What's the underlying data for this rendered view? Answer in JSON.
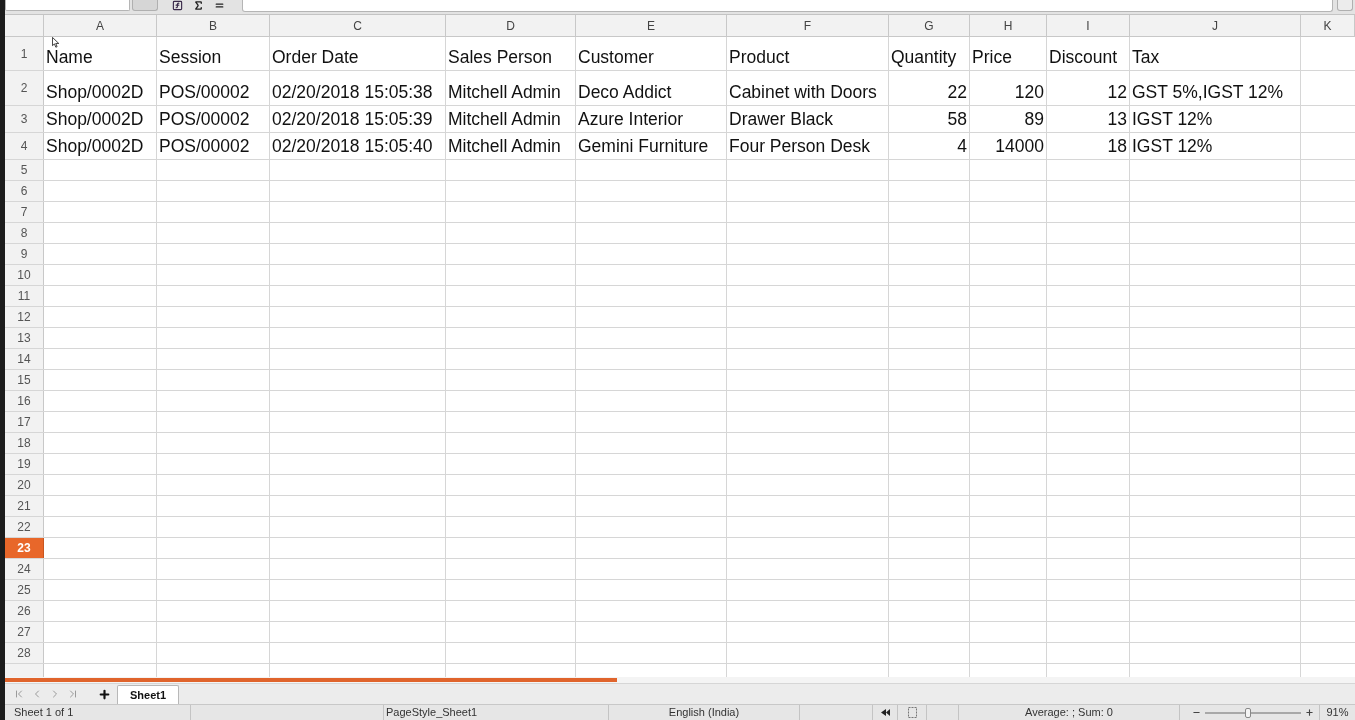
{
  "columns": [
    {
      "label": "A",
      "selected": false
    },
    {
      "label": "B",
      "selected": false
    },
    {
      "label": "C",
      "selected": false
    },
    {
      "label": "D",
      "selected": false
    },
    {
      "label": "E",
      "selected": false
    },
    {
      "label": "F",
      "selected": false
    },
    {
      "label": "G",
      "selected": false
    },
    {
      "label": "H",
      "selected": false
    },
    {
      "label": "I",
      "selected": false
    },
    {
      "label": "J",
      "selected": false
    },
    {
      "label": "K",
      "selected": false
    }
  ],
  "rows": [
    {
      "label": "1",
      "selected": false,
      "cells": [
        {
          "kind": "text",
          "text": "Name"
        },
        {
          "kind": "text",
          "text": "Session"
        },
        {
          "kind": "text",
          "text": "Order Date"
        },
        {
          "kind": "text",
          "text": "Sales Person"
        },
        {
          "kind": "text",
          "text": "Customer"
        },
        {
          "kind": "text",
          "text": "Product"
        },
        {
          "kind": "text",
          "text": "Quantity"
        },
        {
          "kind": "text",
          "text": "Price"
        },
        {
          "kind": "text",
          "text": "Discount"
        },
        {
          "kind": "text",
          "text": "Tax"
        }
      ]
    },
    {
      "label": "2",
      "selected": false,
      "cells": [
        {
          "kind": "text",
          "text": "Shop/0002D"
        },
        {
          "kind": "text",
          "text": "POS/00002"
        },
        {
          "kind": "text",
          "text": "02/20/2018 15:05:38"
        },
        {
          "kind": "text",
          "text": "Mitchell Admin"
        },
        {
          "kind": "text",
          "text": "Deco Addict"
        },
        {
          "kind": "text",
          "text": "Cabinet with Doors"
        },
        {
          "kind": "number",
          "text": "22"
        },
        {
          "kind": "number",
          "text": "120"
        },
        {
          "kind": "number",
          "text": "12"
        },
        {
          "kind": "text",
          "text": "GST 5%,IGST 12%"
        }
      ]
    },
    {
      "label": "3",
      "selected": false,
      "cells": [
        {
          "kind": "text",
          "text": "Shop/0002D"
        },
        {
          "kind": "text",
          "text": "POS/00002"
        },
        {
          "kind": "text",
          "text": "02/20/2018 15:05:39"
        },
        {
          "kind": "text",
          "text": "Mitchell Admin"
        },
        {
          "kind": "text",
          "text": "Azure Interior"
        },
        {
          "kind": "text",
          "text": "Drawer Black"
        },
        {
          "kind": "number",
          "text": "58"
        },
        {
          "kind": "number",
          "text": "89"
        },
        {
          "kind": "number",
          "text": "13"
        },
        {
          "kind": "text",
          "text": "IGST 12%"
        }
      ]
    },
    {
      "label": "4",
      "selected": false,
      "cells": [
        {
          "kind": "text",
          "text": "Shop/0002D"
        },
        {
          "kind": "text",
          "text": "POS/00002"
        },
        {
          "kind": "text",
          "text": "02/20/2018 15:05:40"
        },
        {
          "kind": "text",
          "text": "Mitchell Admin"
        },
        {
          "kind": "text",
          "text": "Gemini Furniture"
        },
        {
          "kind": "text",
          "text": "Four Person Desk"
        },
        {
          "kind": "number",
          "text": "4"
        },
        {
          "kind": "number",
          "text": "14000"
        },
        {
          "kind": "number",
          "text": "18"
        },
        {
          "kind": "text",
          "text": "IGST 12%"
        }
      ]
    },
    {
      "label": "5",
      "selected": false
    },
    {
      "label": "6",
      "selected": false
    },
    {
      "label": "7",
      "selected": false
    },
    {
      "label": "8",
      "selected": false
    },
    {
      "label": "9",
      "selected": false
    },
    {
      "label": "10",
      "selected": false
    },
    {
      "label": "11",
      "selected": false
    },
    {
      "label": "12",
      "selected": false
    },
    {
      "label": "13",
      "selected": false
    },
    {
      "label": "14",
      "selected": false
    },
    {
      "label": "15",
      "selected": false
    },
    {
      "label": "16",
      "selected": false
    },
    {
      "label": "17",
      "selected": false
    },
    {
      "label": "18",
      "selected": false
    },
    {
      "label": "19",
      "selected": false
    },
    {
      "label": "20",
      "selected": false
    },
    {
      "label": "21",
      "selected": false
    },
    {
      "label": "22",
      "selected": false
    },
    {
      "label": "23",
      "selected": true
    },
    {
      "label": "24",
      "selected": false
    },
    {
      "label": "25",
      "selected": false
    },
    {
      "label": "26",
      "selected": false
    },
    {
      "label": "27",
      "selected": false
    },
    {
      "label": "28",
      "selected": false
    }
  ],
  "sheet_tabs": [
    {
      "label": "Sheet1",
      "selected": true
    }
  ],
  "status_bar": {
    "sheet": "Sheet 1 of 1",
    "page_style": "PageStyle_Sheet1",
    "language": "English (India)",
    "summary": "Average: ; Sum: 0",
    "zoom_slider": {
      "level": 0.45
    },
    "zoom": "91%"
  }
}
